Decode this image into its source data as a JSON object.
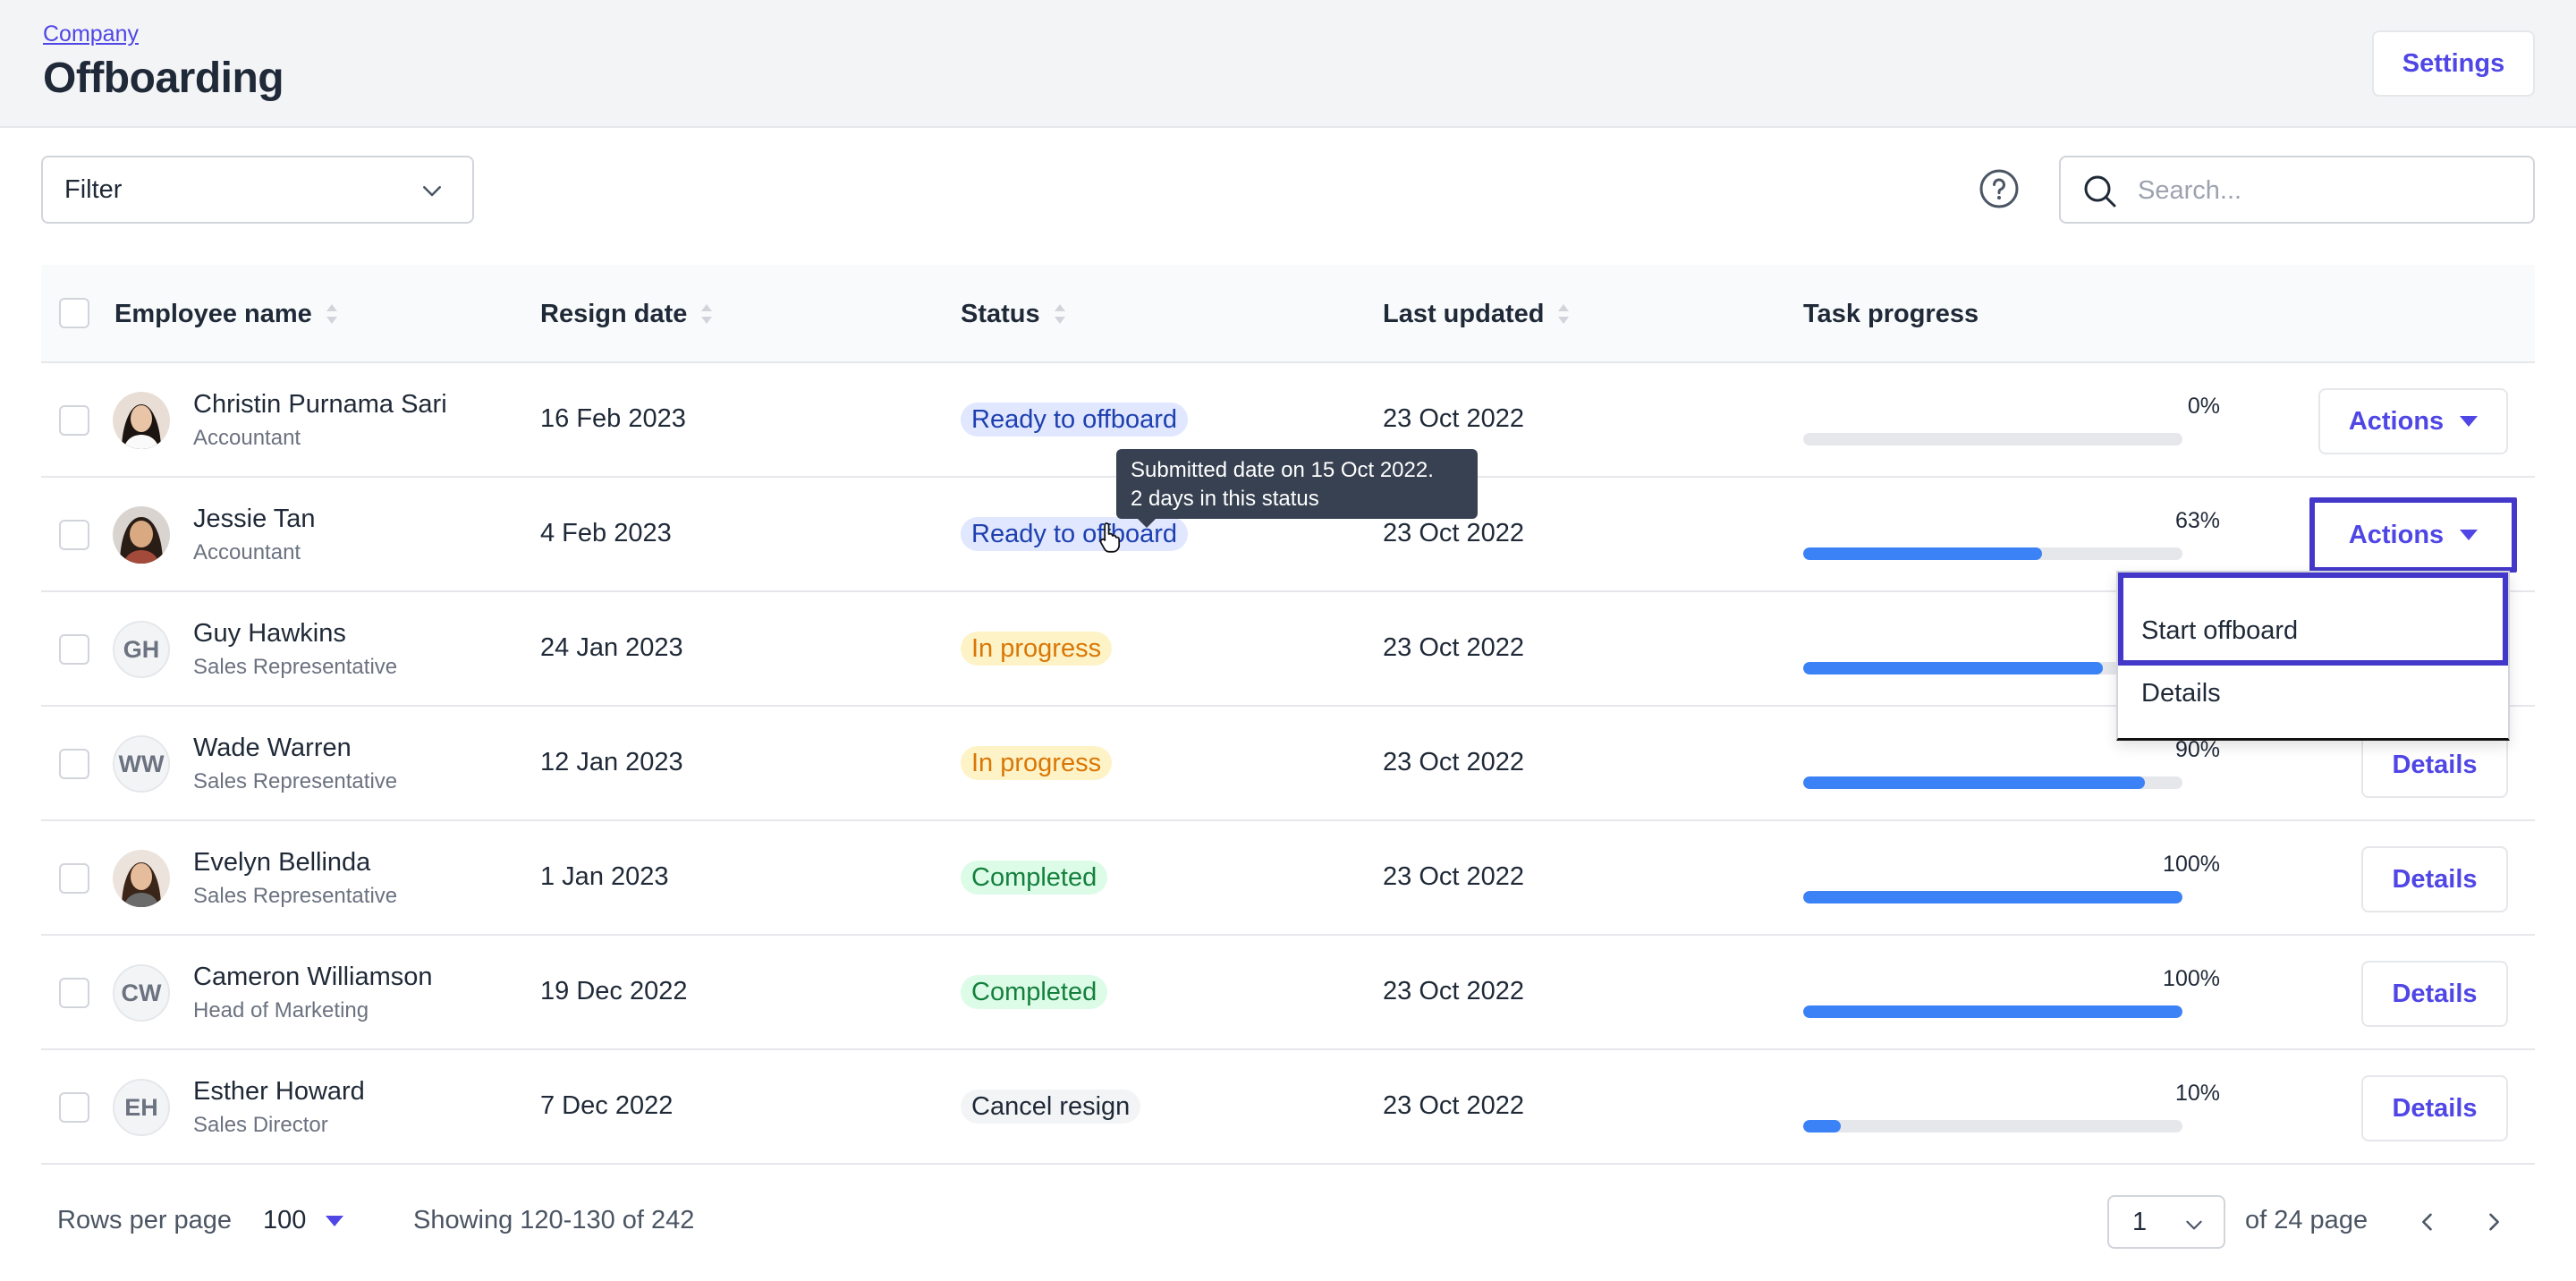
{
  "header": {
    "breadcrumb": "Company",
    "title": "Offboarding",
    "settings_label": "Settings"
  },
  "toolbar": {
    "filter_label": "Filter",
    "search_placeholder": "Search..."
  },
  "table": {
    "columns": [
      "Employee name",
      "Resign date",
      "Status",
      "Last updated",
      "Task progress"
    ],
    "rows": [
      {
        "name": "Christin Purnama Sari",
        "role": "Accountant",
        "initials": "",
        "resign_date": "16 Feb 2023",
        "status": "Ready to offboard",
        "last_updated": "23 Oct 2022",
        "progress_label": "0%",
        "progress": 0,
        "action": "Actions"
      },
      {
        "name": "Jessie Tan",
        "role": "Accountant",
        "initials": "",
        "resign_date": "4 Feb 2023",
        "status": "Ready to offboard",
        "last_updated": "23 Oct 2022",
        "progress_label": "63%",
        "progress": 63,
        "action": "Actions"
      },
      {
        "name": "Guy Hawkins",
        "role": "Sales Representative",
        "initials": "GH",
        "resign_date": "24 Jan 2023",
        "status": "In progress",
        "last_updated": "23 Oct 2022",
        "progress_label": "",
        "progress": 79,
        "action": ""
      },
      {
        "name": "Wade Warren",
        "role": "Sales Representative",
        "initials": "WW",
        "resign_date": "12 Jan 2023",
        "status": "In progress",
        "last_updated": "23 Oct 2022",
        "progress_label": "90%",
        "progress": 90,
        "action": "Details"
      },
      {
        "name": "Evelyn Bellinda",
        "role": "Sales Representative",
        "initials": "",
        "resign_date": "1 Jan 2023",
        "status": "Completed",
        "last_updated": "23 Oct 2022",
        "progress_label": "100%",
        "progress": 100,
        "action": "Details"
      },
      {
        "name": "Cameron Williamson",
        "role": "Head of Marketing",
        "initials": "CW",
        "resign_date": "19 Dec 2022",
        "status": "Completed",
        "last_updated": "23 Oct 2022",
        "progress_label": "100%",
        "progress": 100,
        "action": "Details"
      },
      {
        "name": "Esther Howard",
        "role": "Sales Director",
        "initials": "EH",
        "resign_date": "7 Dec 2022",
        "status": "Cancel resign",
        "last_updated": "23 Oct 2022",
        "progress_label": "10%",
        "progress": 10,
        "action": "Details"
      }
    ]
  },
  "dropdown": {
    "items": [
      "Start offboard",
      "Details"
    ]
  },
  "tooltip": {
    "line1": "Submitted date on 15 Oct 2022.",
    "line2": "2 days in this status"
  },
  "footer": {
    "rows_per_page_label": "Rows per page",
    "rows_per_page_value": "100",
    "showing": "Showing 120-130 of 242",
    "page_value": "1",
    "of_pages": "of 24 page"
  },
  "colors": {
    "accent": "#4f46e5",
    "focus_ring": "#4338ca",
    "progress_fill": "#3b82f6"
  }
}
